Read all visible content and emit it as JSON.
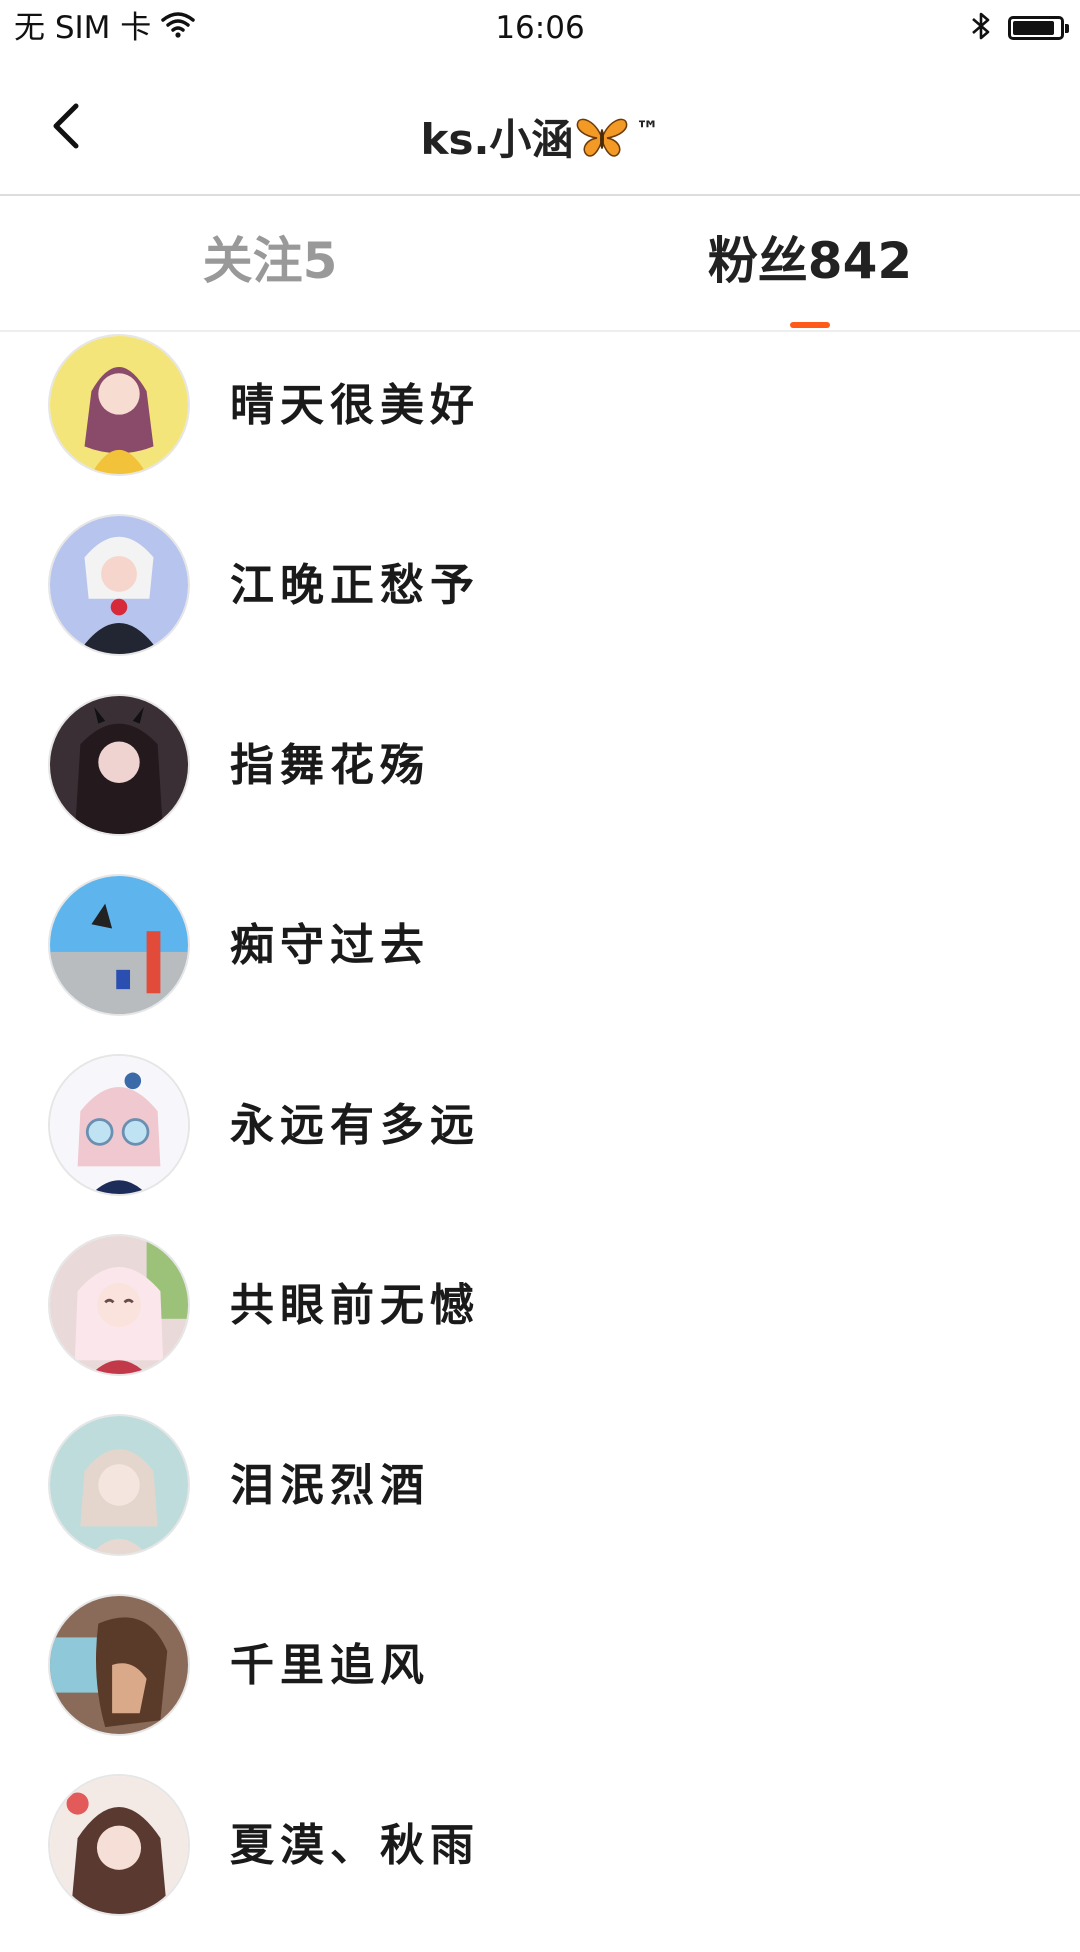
{
  "status_bar": {
    "carrier": "无 SIM 卡",
    "time": "16:06",
    "battery_level": 0.9,
    "icons": [
      "wifi-icon",
      "bluetooth-icon",
      "battery-icon"
    ]
  },
  "nav": {
    "back_icon": "chevron-left-icon",
    "title": "ks.小涵",
    "title_emoji": "butterfly-emoji",
    "title_suffix": "™"
  },
  "tabs": [
    {
      "label": "关注5",
      "active": false
    },
    {
      "label": "粉丝842",
      "active": true
    }
  ],
  "colors": {
    "accent": "#ff5a1a",
    "text_primary": "#222222",
    "text_inactive": "#999999",
    "divider": "#dddddd"
  },
  "fans": [
    {
      "name": "晴天很美好"
    },
    {
      "name": "江晚正愁予"
    },
    {
      "name": "指舞花殇"
    },
    {
      "name": "痴守过去"
    },
    {
      "name": "永远有多远"
    },
    {
      "name": "共眼前无憾"
    },
    {
      "name": "泪泯烈酒"
    },
    {
      "name": "千里追风"
    },
    {
      "name": "夏漠、秋雨"
    }
  ]
}
